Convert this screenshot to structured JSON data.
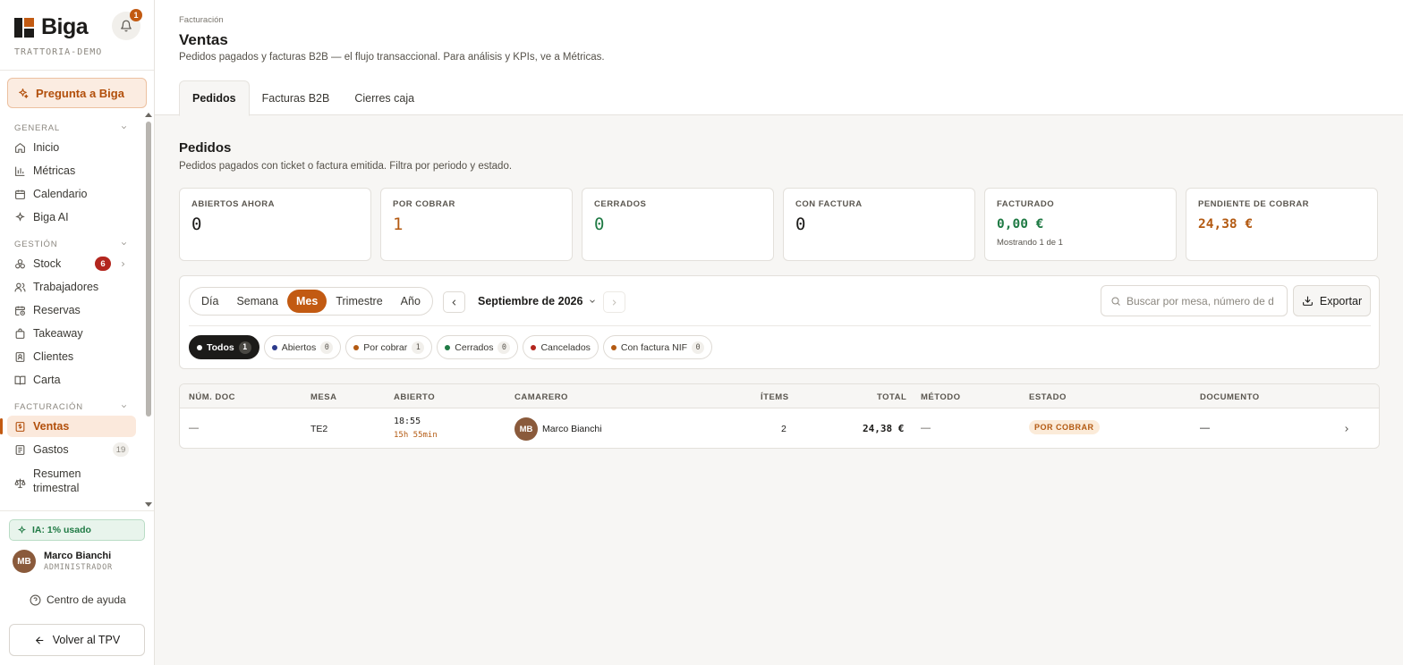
{
  "app": {
    "brand": "Biga",
    "tenant": "TRATTORIA-DEMO",
    "notifications": "1",
    "ask_label": "Pregunta a Biga"
  },
  "sidebar": {
    "sections": [
      {
        "label": "GENERAL",
        "items": [
          {
            "label": "Inicio",
            "icon": "home-icon"
          },
          {
            "label": "Métricas",
            "icon": "bar-chart-icon"
          },
          {
            "label": "Calendario",
            "icon": "calendar-icon"
          },
          {
            "label": "Biga AI",
            "icon": "sparkle-icon"
          }
        ]
      },
      {
        "label": "GESTIÓN",
        "items": [
          {
            "label": "Stock",
            "icon": "boxes-icon",
            "badge": "6"
          },
          {
            "label": "Trabajadores",
            "icon": "users-icon"
          },
          {
            "label": "Reservas",
            "icon": "calendar-clock-icon"
          },
          {
            "label": "Takeaway",
            "icon": "bag-icon"
          },
          {
            "label": "Clientes",
            "icon": "contacts-icon"
          },
          {
            "label": "Carta",
            "icon": "book-icon"
          }
        ]
      },
      {
        "label": "FACTURACIÓN",
        "items": [
          {
            "label": "Ventas",
            "icon": "receipt-icon",
            "active": true
          },
          {
            "label": "Gastos",
            "icon": "document-icon",
            "badge": "19"
          },
          {
            "label": "Resumen",
            "label2": "trimestral",
            "icon": "scale-icon"
          }
        ]
      }
    ],
    "ia_usage": "IA: 1% usado",
    "user": {
      "initials": "MB",
      "name": "Marco Bianchi",
      "role": "ADMINISTRADOR"
    },
    "help_label": "Centro de ayuda",
    "back_label": "Volver al TPV"
  },
  "header": {
    "breadcrumb": "Facturación",
    "title": "Ventas",
    "description": "Pedidos pagados y facturas B2B — el flujo transaccional. Para análisis y KPIs, ve a Métricas.",
    "tabs": [
      "Pedidos",
      "Facturas B2B",
      "Cierres caja"
    ]
  },
  "section": {
    "title": "Pedidos",
    "description": "Pedidos pagados con ticket o factura emitida. Filtra por periodo y estado."
  },
  "kpis": [
    {
      "label": "ABIERTOS AHORA",
      "value": "0",
      "color": "#1c1b19"
    },
    {
      "label": "POR COBRAR",
      "value": "1",
      "color": "#b35a12"
    },
    {
      "label": "CERRADOS",
      "value": "0",
      "color": "#1f7a44"
    },
    {
      "label": "CON FACTURA",
      "value": "0",
      "color": "#1c1b19"
    },
    {
      "label": "FACTURADO",
      "value": "0,00 €",
      "note": "Mostrando 1 de 1",
      "color": "#1f7a44"
    },
    {
      "label": "PENDIENTE DE COBRAR",
      "value": "24,38 €",
      "color": "#b35a12"
    }
  ],
  "filters": {
    "periods": [
      "Día",
      "Semana",
      "Mes",
      "Trimestre",
      "Año"
    ],
    "active_period": "Mes",
    "month": "Septiembre de 2026",
    "search_placeholder": "Buscar por mesa, número de d",
    "export_label": "Exportar",
    "chips": [
      {
        "label": "Todos",
        "count": "1",
        "color": "#ffffff",
        "active": true
      },
      {
        "label": "Abiertos",
        "count": "0",
        "color": "#2c3a8c"
      },
      {
        "label": "Por cobrar",
        "count": "1",
        "color": "#b35a12"
      },
      {
        "label": "Cerrados",
        "count": "0",
        "color": "#1f7a44"
      },
      {
        "label": "Cancelados",
        "color": "#b3261e"
      },
      {
        "label": "Con factura NIF",
        "count": "0",
        "color": "#b35a12"
      }
    ]
  },
  "table": {
    "columns": [
      "NÚM. DOC",
      "MESA",
      "ABIERTO",
      "CAMARERO",
      "ÍTEMS",
      "TOTAL",
      "MÉTODO",
      "ESTADO",
      "DOCUMENTO"
    ],
    "rows": [
      {
        "doc": "—",
        "mesa": "TE2",
        "abierto": "18:55",
        "duracion": "15h 55min",
        "camarero_initials": "MB",
        "camarero": "Marco Bianchi",
        "items": "2",
        "total": "24,38 €",
        "metodo": "—",
        "estado": "POR COBRAR",
        "documento": "—"
      }
    ]
  }
}
